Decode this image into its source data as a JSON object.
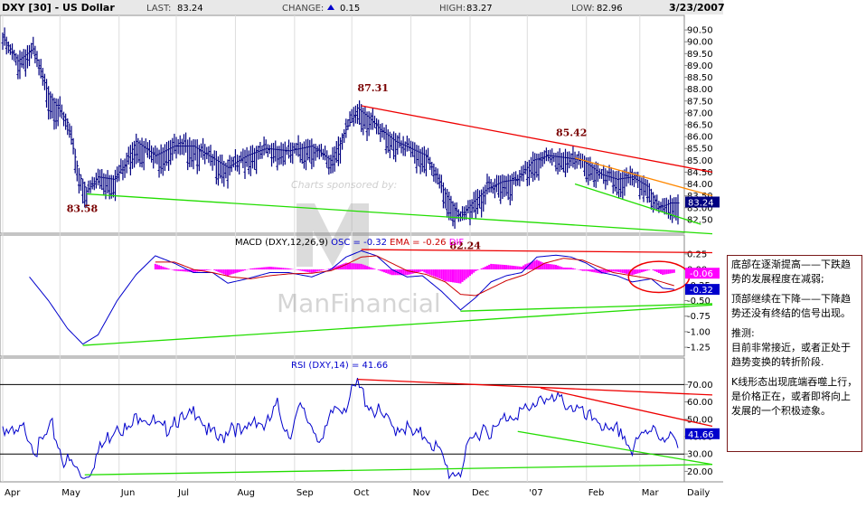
{
  "header": {
    "symbol": "DXY [30] - US Dollar",
    "last_label": "LAST:",
    "last": "83.24",
    "change_label": "CHANGE:",
    "change": "0.15",
    "high_label": "HIGH:",
    "high": "83.27",
    "low_label": "LOW:",
    "low": "82.96",
    "date": "3/23/2007"
  },
  "watermark": {
    "line1": "Charts sponsored by:",
    "brand": "ManFinancial"
  },
  "colors": {
    "price": "#000080",
    "macd": "#0000cc",
    "ema": "#cc0000",
    "osc": "#ff00ff",
    "rsi": "#0000cc",
    "trend_red": "#ee0000",
    "trend_green": "#22dd00",
    "trend_orange": "#ff8800",
    "grid": "#dddddd"
  },
  "chart_data": [
    {
      "type": "line",
      "panel": "price",
      "ylim": [
        82,
        91
      ],
      "yticks": [
        82.5,
        83.0,
        83.5,
        84.0,
        84.5,
        85.0,
        85.5,
        86.0,
        86.5,
        87.0,
        87.5,
        88.0,
        88.5,
        89.0,
        89.5,
        90.0,
        90.5
      ],
      "ytick_labels": [
        "82.50",
        "83.00",
        "83.50",
        "84.00",
        "84.50",
        "85.00",
        "85.50",
        "86.00",
        "86.50",
        "87.00",
        "87.50",
        "88.00",
        "88.50",
        "89.00",
        "89.50",
        "90.00",
        "90.50"
      ],
      "xlim": [
        0,
        354
      ],
      "xticks": [
        0,
        30,
        61,
        91,
        122,
        153,
        183,
        214,
        245,
        275,
        306,
        334
      ],
      "xtick_labels": [
        "Apr",
        "May",
        "Jun",
        "Jul",
        "Aug",
        "Sep",
        "Oct",
        "Nov",
        "Dec",
        "'07",
        "Feb",
        "Mar"
      ],
      "xaxis_right_label": "Daily",
      "keypoints": [
        [
          0,
          90.2
        ],
        [
          8,
          89.2
        ],
        [
          16,
          89.7
        ],
        [
          24,
          87.8
        ],
        [
          34,
          86.6
        ],
        [
          40,
          84.4
        ],
        [
          44,
          83.7
        ],
        [
          50,
          84.3
        ],
        [
          58,
          84.2
        ],
        [
          64,
          84.8
        ],
        [
          70,
          85.8
        ],
        [
          80,
          85.2
        ],
        [
          90,
          85.6
        ],
        [
          100,
          85.6
        ],
        [
          110,
          85.1
        ],
        [
          118,
          84.7
        ],
        [
          128,
          85.2
        ],
        [
          138,
          85.5
        ],
        [
          150,
          85.4
        ],
        [
          162,
          85.6
        ],
        [
          172,
          85.0
        ],
        [
          180,
          86.3
        ],
        [
          186,
          87.2
        ],
        [
          192,
          86.8
        ],
        [
          198,
          86.3
        ],
        [
          206,
          85.8
        ],
        [
          214,
          85.5
        ],
        [
          222,
          85.2
        ],
        [
          232,
          83.6
        ],
        [
          240,
          82.6
        ],
        [
          246,
          83.2
        ],
        [
          254,
          83.8
        ],
        [
          262,
          84.1
        ],
        [
          270,
          84.2
        ],
        [
          278,
          85.0
        ],
        [
          286,
          85.2
        ],
        [
          296,
          85.1
        ],
        [
          304,
          85.0
        ],
        [
          314,
          84.4
        ],
        [
          322,
          84.2
        ],
        [
          330,
          84.3
        ],
        [
          338,
          83.9
        ],
        [
          344,
          83.0
        ],
        [
          350,
          83.2
        ],
        [
          354,
          83.2
        ]
      ],
      "annotations": [
        {
          "text": "83.58",
          "x": 43,
          "y": 83.58
        },
        {
          "text": "87.31",
          "x": 186,
          "y": 87.31
        },
        {
          "text": "85.42",
          "x": 290,
          "y": 85.42
        },
        {
          "text": "82.24",
          "x": 240,
          "y": 82.24
        }
      ],
      "last_value_label": "83.24",
      "trendlines": [
        {
          "color": "red",
          "from": [
            188,
            87.3
          ],
          "to": [
            372,
            84.5
          ]
        },
        {
          "color": "orange",
          "from": [
            300,
            85.1
          ],
          "to": [
            372,
            83.5
          ]
        },
        {
          "color": "green",
          "from": [
            44,
            83.58
          ],
          "to": [
            372,
            81.9
          ]
        },
        {
          "color": "green",
          "from": [
            300,
            84.0
          ],
          "to": [
            366,
            82.3
          ]
        }
      ]
    },
    {
      "type": "line",
      "panel": "macd",
      "title_macd": "MACD (DXY,12,26,9)",
      "title_osc": "OSC = -0.32",
      "title_ema": "EMA = -0.26",
      "title_dif": "DIF",
      "ylim": [
        -1.35,
        0.35
      ],
      "yticks": [
        0.25,
        0,
        -0.25,
        -0.5,
        -0.75,
        -1.0,
        -1.25
      ],
      "ytick_labels": [
        "0.25",
        "0.00",
        "-0.25",
        "-0.50",
        "-0.75",
        "-1.00",
        "-1.25"
      ],
      "macd_keypoints": [
        [
          14,
          -0.12
        ],
        [
          24,
          -0.5
        ],
        [
          34,
          -0.95
        ],
        [
          42,
          -1.2
        ],
        [
          50,
          -1.05
        ],
        [
          60,
          -0.5
        ],
        [
          70,
          -0.08
        ],
        [
          80,
          0.22
        ],
        [
          90,
          0.1
        ],
        [
          100,
          -0.05
        ],
        [
          110,
          -0.05
        ],
        [
          118,
          -0.22
        ],
        [
          128,
          -0.15
        ],
        [
          140,
          -0.05
        ],
        [
          150,
          -0.05
        ],
        [
          162,
          -0.12
        ],
        [
          172,
          0.0
        ],
        [
          180,
          0.2
        ],
        [
          188,
          0.3
        ],
        [
          196,
          0.22
        ],
        [
          204,
          0.0
        ],
        [
          212,
          -0.12
        ],
        [
          220,
          -0.1
        ],
        [
          230,
          -0.35
        ],
        [
          240,
          -0.65
        ],
        [
          248,
          -0.45
        ],
        [
          256,
          -0.2
        ],
        [
          264,
          -0.1
        ],
        [
          272,
          -0.05
        ],
        [
          280,
          0.2
        ],
        [
          290,
          0.23
        ],
        [
          298,
          0.2
        ],
        [
          306,
          0.1
        ],
        [
          314,
          -0.05
        ],
        [
          322,
          -0.1
        ],
        [
          330,
          -0.2
        ],
        [
          340,
          -0.15
        ],
        [
          346,
          -0.3
        ],
        [
          352,
          -0.32
        ]
      ],
      "ema_keypoints": [
        [
          80,
          0.12
        ],
        [
          90,
          0.12
        ],
        [
          100,
          0.0
        ],
        [
          110,
          -0.05
        ],
        [
          120,
          -0.12
        ],
        [
          130,
          -0.15
        ],
        [
          140,
          -0.1
        ],
        [
          150,
          -0.07
        ],
        [
          162,
          -0.06
        ],
        [
          172,
          -0.02
        ],
        [
          180,
          0.08
        ],
        [
          188,
          0.2
        ],
        [
          196,
          0.22
        ],
        [
          204,
          0.1
        ],
        [
          212,
          -0.02
        ],
        [
          222,
          -0.08
        ],
        [
          232,
          -0.2
        ],
        [
          240,
          -0.4
        ],
        [
          248,
          -0.42
        ],
        [
          256,
          -0.3
        ],
        [
          264,
          -0.18
        ],
        [
          274,
          -0.08
        ],
        [
          284,
          0.1
        ],
        [
          294,
          0.18
        ],
        [
          304,
          0.15
        ],
        [
          312,
          0.05
        ],
        [
          320,
          -0.05
        ],
        [
          330,
          -0.1
        ],
        [
          340,
          -0.15
        ],
        [
          352,
          -0.26
        ]
      ],
      "osc_value_label": "-0.06",
      "macd_value_label": "-0.32",
      "trendlines": [
        {
          "color": "red",
          "from": [
            188,
            0.32
          ],
          "to": [
            372,
            0.27
          ]
        },
        {
          "color": "green",
          "from": [
            42,
            -1.22
          ],
          "to": [
            372,
            -0.57
          ]
        },
        {
          "color": "green",
          "from": [
            240,
            -0.67
          ],
          "to": [
            372,
            -0.55
          ]
        }
      ],
      "highlight_ellipse": {
        "cx": 344,
        "cy": -0.12,
        "rx": 16,
        "ry": 0.25
      }
    },
    {
      "type": "line",
      "panel": "rsi",
      "title": "RSI (DXY,14) = 41.66",
      "ylim": [
        15,
        78
      ],
      "yticks": [
        70,
        60,
        50,
        40,
        30,
        20
      ],
      "ytick_labels": [
        "70.00",
        "60.00",
        "50.00",
        "40.00",
        "30.00",
        "20.00"
      ],
      "reference_lines": [
        70,
        30
      ],
      "rsi_keypoints": [
        [
          0,
          50
        ],
        [
          6,
          42
        ],
        [
          12,
          48
        ],
        [
          18,
          35
        ],
        [
          26,
          48
        ],
        [
          32,
          30
        ],
        [
          38,
          25
        ],
        [
          43,
          18
        ],
        [
          48,
          30
        ],
        [
          54,
          40
        ],
        [
          60,
          52
        ],
        [
          66,
          45
        ],
        [
          72,
          58
        ],
        [
          78,
          52
        ],
        [
          84,
          45
        ],
        [
          90,
          55
        ],
        [
          96,
          50
        ],
        [
          102,
          60
        ],
        [
          108,
          45
        ],
        [
          114,
          40
        ],
        [
          120,
          52
        ],
        [
          126,
          42
        ],
        [
          132,
          55
        ],
        [
          138,
          48
        ],
        [
          144,
          60
        ],
        [
          150,
          45
        ],
        [
          156,
          58
        ],
        [
          162,
          50
        ],
        [
          168,
          40
        ],
        [
          174,
          60
        ],
        [
          180,
          62
        ],
        [
          186,
          72
        ],
        [
          192,
          62
        ],
        [
          198,
          55
        ],
        [
          204,
          48
        ],
        [
          210,
          50
        ],
        [
          216,
          42
        ],
        [
          222,
          45
        ],
        [
          228,
          35
        ],
        [
          234,
          22
        ],
        [
          240,
          24
        ],
        [
          246,
          40
        ],
        [
          252,
          50
        ],
        [
          258,
          45
        ],
        [
          264,
          55
        ],
        [
          270,
          58
        ],
        [
          276,
          56
        ],
        [
          282,
          68
        ],
        [
          288,
          62
        ],
        [
          294,
          64
        ],
        [
          300,
          60
        ],
        [
          306,
          52
        ],
        [
          312,
          55
        ],
        [
          318,
          42
        ],
        [
          324,
          48
        ],
        [
          330,
          34
        ],
        [
          336,
          44
        ],
        [
          342,
          52
        ],
        [
          346,
          38
        ],
        [
          352,
          42
        ],
        [
          354,
          41.66
        ]
      ],
      "last_value_label": "41.66",
      "trendlines": [
        {
          "color": "red",
          "from": [
            186,
            73
          ],
          "to": [
            372,
            64
          ]
        },
        {
          "color": "red",
          "from": [
            282,
            68
          ],
          "to": [
            372,
            46
          ]
        },
        {
          "color": "green",
          "from": [
            43,
            18
          ],
          "to": [
            372,
            24
          ]
        },
        {
          "color": "green",
          "from": [
            270,
            43
          ],
          "to": [
            372,
            24
          ]
        }
      ]
    }
  ],
  "notes": [
    "底部在逐渐提高——下跌趋势的发展程度在减弱;",
    "顶部继续在下降——下降趋势还没有终结的信号出现。",
    "推测:\n目前非常接近，或者正处于趋势变换的转折阶段.",
    "K线形态出现底端吞噬上行，是价格正在，或者即将向上发展的一个积极迹象。"
  ]
}
